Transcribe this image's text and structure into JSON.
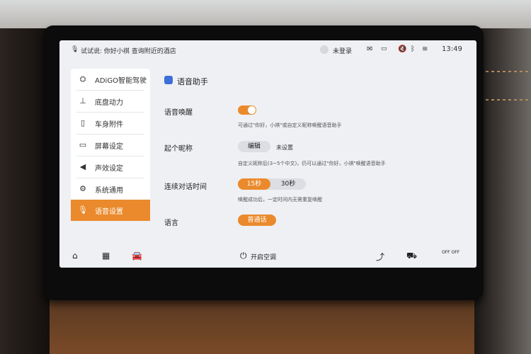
{
  "status_bar": {
    "hint": "试试说: 你好小祺 查询附近的酒店",
    "user": "未登录",
    "time": "13:49",
    "icons": [
      "mic-hint-icon",
      "avatar-icon",
      "message-icon",
      "display-off-icon",
      "mute-icon",
      "bluetooth-icon",
      "wifi-icon"
    ]
  },
  "sidebar": {
    "items": [
      {
        "label": "ADiGO智能驾驶",
        "icon": "steering-icon"
      },
      {
        "label": "底盘动力",
        "icon": "chassis-icon"
      },
      {
        "label": "车身附件",
        "icon": "door-icon"
      },
      {
        "label": "屏幕设定",
        "icon": "screen-icon"
      },
      {
        "label": "声效设定",
        "icon": "speaker-icon"
      },
      {
        "label": "系统通用",
        "icon": "gear-icon"
      },
      {
        "label": "语音设置",
        "icon": "mic-icon",
        "active": true
      }
    ]
  },
  "content": {
    "title": "语音助手",
    "wake": {
      "label": "语音唤醒",
      "enabled": true,
      "hint": "可通过\"你好，小祺\"或自定义昵称唤醒语音助手"
    },
    "nickname": {
      "label": "起个昵称",
      "button": "编辑",
      "value": "未设置",
      "hint": "自定义昵称后(3~5个中文)，仍可以通过\"你好，小祺\"唤醒语音助手"
    },
    "continuous": {
      "label": "连续对话时间",
      "options": [
        "15秒",
        "30秒"
      ],
      "selected": "15秒",
      "hint": "唤醒成功后，一定时间内无需重复唤醒"
    },
    "language": {
      "label": "语言",
      "value": "普通话"
    }
  },
  "bottom_bar": {
    "ac_label": "开启空调",
    "left_icons": [
      "home-icon",
      "apps-icon",
      "car-icon"
    ],
    "right_icons": [
      "seat-icon",
      "vehicle-view-icon",
      "off-off-icon"
    ],
    "off_label": "OFF OFF"
  },
  "colors": {
    "accent": "#ea8a2c",
    "screen_bg": "#eef0f3",
    "mic_blue": "#3b6fd9"
  }
}
